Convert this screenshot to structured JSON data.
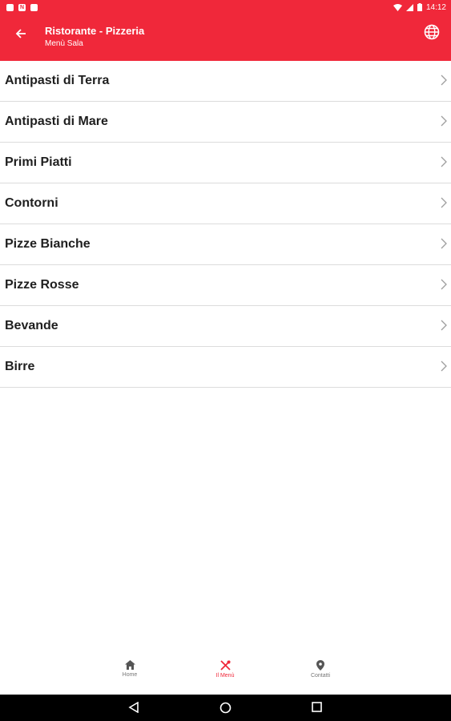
{
  "status_bar": {
    "time": "14:12"
  },
  "app_bar": {
    "title": "Ristorante - Pizzeria",
    "subtitle": "Menù Sala",
    "color": "#f0283a"
  },
  "menu": {
    "items": [
      {
        "label": "Antipasti di Terra"
      },
      {
        "label": "Antipasti di Mare"
      },
      {
        "label": "Primi Piatti"
      },
      {
        "label": "Contorni"
      },
      {
        "label": "Pizze Bianche"
      },
      {
        "label": "Pizze Rosse"
      },
      {
        "label": "Bevande"
      },
      {
        "label": "Birre"
      }
    ]
  },
  "bottom_nav": {
    "items": [
      {
        "label": "Home",
        "icon": "home-icon"
      },
      {
        "label": "Il Menù",
        "icon": "cutlery-icon",
        "active": true
      },
      {
        "label": "Contatti",
        "icon": "location-pin-icon"
      }
    ]
  },
  "system_nav": {
    "buttons": [
      "back-icon",
      "home-circle-icon",
      "recents-icon"
    ]
  }
}
